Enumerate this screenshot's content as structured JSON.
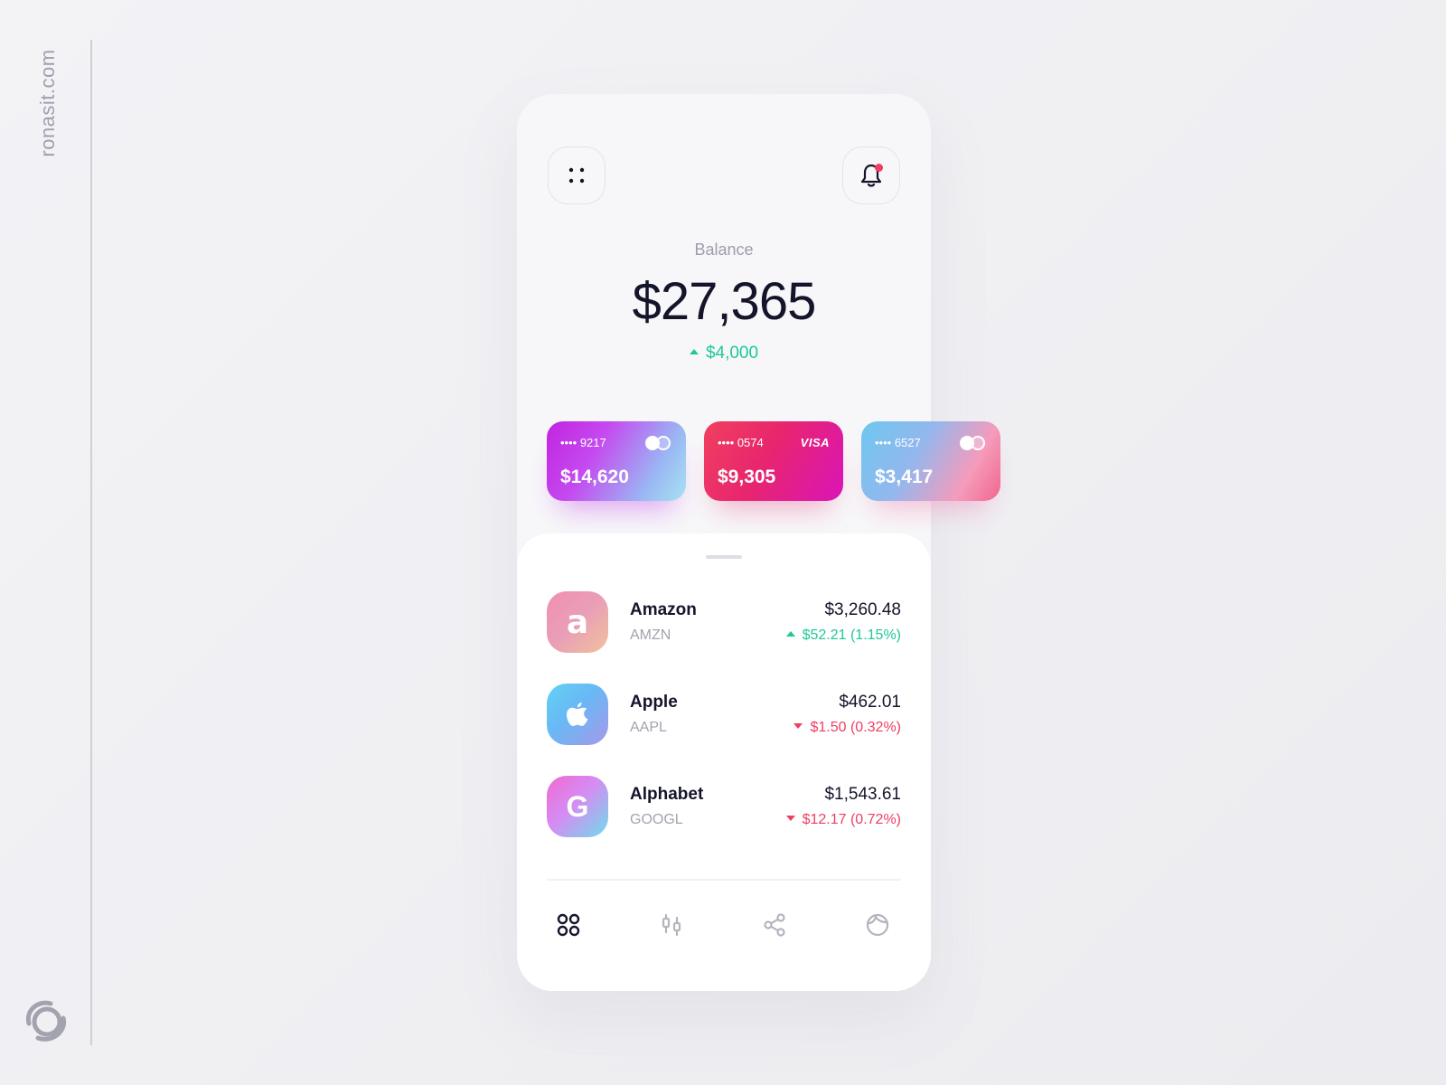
{
  "site": {
    "label": "ronasit.com"
  },
  "header": {
    "menu_icon": "grid-dots-icon",
    "bell_icon": "bell-icon",
    "has_notification": true
  },
  "balance": {
    "label": "Balance",
    "value": "$27,365",
    "change": "$4,000",
    "change_direction": "up"
  },
  "cards": [
    {
      "number": "•••• 9217",
      "amount": "$14,620",
      "network": "mastercard"
    },
    {
      "number": "•••• 0574",
      "amount": "$9,305",
      "network": "VISA"
    },
    {
      "number": "•••• 6527",
      "amount": "$3,417",
      "network": "mastercard"
    }
  ],
  "stocks": [
    {
      "name": "Amazon",
      "ticker": "AMZN",
      "logo_letter": "a",
      "price": "$3,260.48",
      "change": "$52.21 (1.15%)",
      "direction": "up"
    },
    {
      "name": "Apple",
      "ticker": "AAPL",
      "logo_icon": "apple-icon",
      "price": "$462.01",
      "change": "$1.50 (0.32%)",
      "direction": "down"
    },
    {
      "name": "Alphabet",
      "ticker": "GOOGL",
      "logo_letter": "G",
      "price": "$1,543.61",
      "change": "$12.17 (0.72%)",
      "direction": "down"
    }
  ],
  "nav": [
    {
      "icon": "dashboard-icon",
      "active": true
    },
    {
      "icon": "candlestick-icon",
      "active": false
    },
    {
      "icon": "share-icon",
      "active": false
    },
    {
      "icon": "profile-icon",
      "active": false
    }
  ],
  "colors": {
    "positive": "#20c79a",
    "negative": "#ef3d63",
    "text_primary": "#14142b",
    "text_muted": "#9d9dab",
    "nav_active": "#14142b",
    "nav_inactive": "#b4b4bf"
  }
}
